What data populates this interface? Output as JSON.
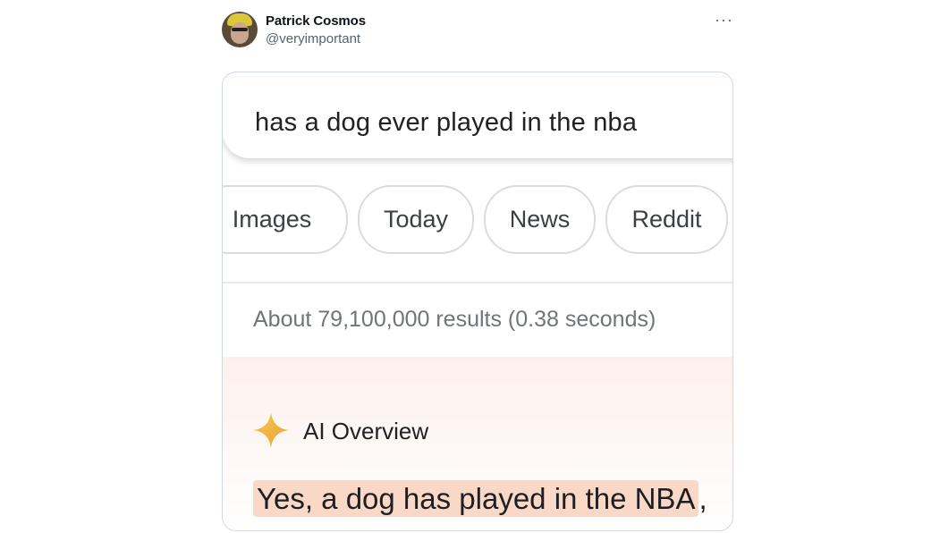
{
  "post": {
    "author_name": "Patrick Cosmos",
    "author_handle": "@veryimportant",
    "more_label": "···"
  },
  "search": {
    "query": "has a dog ever played in the nba"
  },
  "chips": [
    "Images",
    "Today",
    "News",
    "Reddit"
  ],
  "stats": "About 79,100,000 results (0.38 seconds)",
  "ai_overview": {
    "title": "AI Overview",
    "answer": "Yes, a dog has played in the NBA",
    "answer_punct": ","
  },
  "colors": {
    "sparkle": "#f4b400",
    "highlight": "#f9d8c8"
  }
}
